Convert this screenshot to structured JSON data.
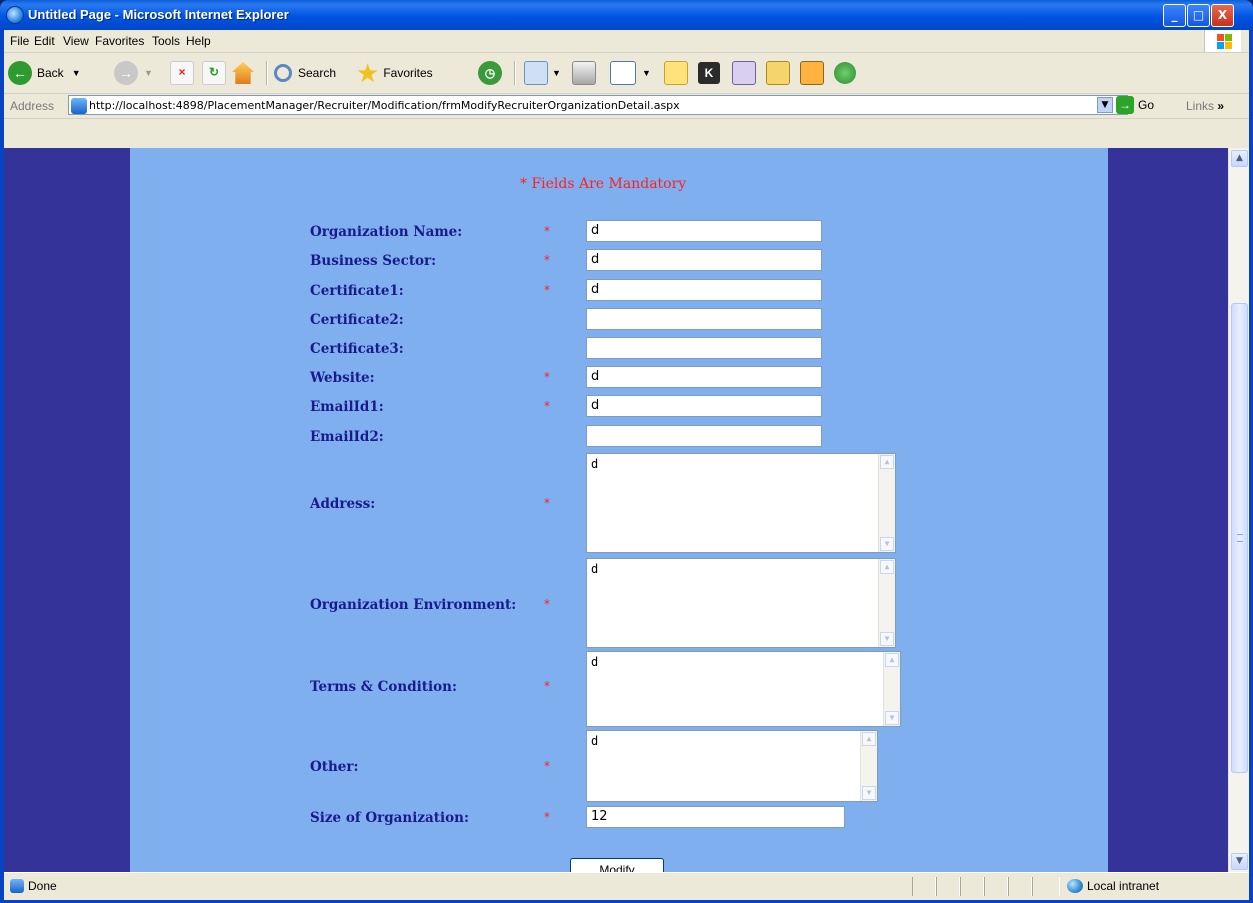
{
  "window": {
    "title": "Untitled Page - Microsoft Internet Explorer",
    "min_glyph": "_",
    "max_glyph": "□",
    "close_glyph": "X"
  },
  "menu": {
    "items": [
      "File",
      "Edit",
      "View",
      "Favorites",
      "Tools",
      "Help"
    ]
  },
  "toolbar": {
    "back_label": "Back",
    "search_label": "Search",
    "favorites_label": "Favorites"
  },
  "address": {
    "label": "Address",
    "url": "http://localhost:4898/PlacementManager/Recruiter/Modification/frmModifyRecruiterOrganizationDetail.aspx",
    "go_label": "Go",
    "links_label": "Links",
    "links_chevron": "»"
  },
  "form": {
    "mandatory_note": "* Fields Are Mandatory",
    "star": "*",
    "fields": [
      {
        "label": "Organization Name:",
        "value": "d"
      },
      {
        "label": "Business Sector:",
        "value": "d"
      },
      {
        "label": "Certificate1:",
        "value": "d"
      },
      {
        "label": "Certificate2:",
        "value": ""
      },
      {
        "label": "Certificate3:",
        "value": ""
      },
      {
        "label": "Website:",
        "value": "d"
      },
      {
        "label": "EmailId1:",
        "value": "d"
      },
      {
        "label": "EmailId2:",
        "value": ""
      },
      {
        "label": "Address:",
        "value": "d"
      },
      {
        "label": "Organization Environment:",
        "value": "d"
      },
      {
        "label": "Terms & Condition:",
        "value": "d"
      },
      {
        "label": "Other:",
        "value": "d"
      },
      {
        "label": "Size of Organization:",
        "value": "12"
      }
    ],
    "submit_label": "Modify"
  },
  "status": {
    "text": "Done",
    "zone": "Local intranet"
  },
  "colors": {
    "page_bg": "#333399",
    "content_bg": "#7fafef",
    "label_color": "#1a1a8a",
    "mandatory_color": "#ff2020"
  }
}
